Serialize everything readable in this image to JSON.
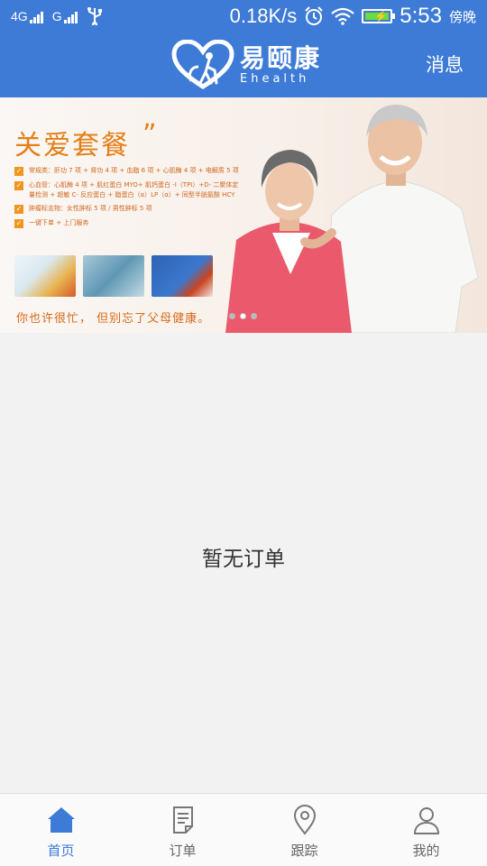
{
  "status_bar": {
    "signal_1": "4G",
    "signal_2": "G",
    "speed": "0.18K/s",
    "time": "5:53",
    "period": "傍晚"
  },
  "app_bar": {
    "logo_cn": "易颐康",
    "logo_en": "Ehealth",
    "messages_label": "消息"
  },
  "banner": {
    "title": "关爱套餐",
    "items": [
      "常规类：肝功 7 项 + 肾功 4 项 + 血脂 6 项 + 心肌酶 4 项 + 电解质 5 项",
      "心血管：心肌酶 4 项 + 肌红蛋白 MYO+ 肌钙蛋白 -I（TPI）+D- 二聚体定量检测 + 超敏 C- 反应蛋白 + 脂蛋白（α）LP（α）+ 同型半胱氨酸 HCY",
      "肿瘤标志物：女性肿标 5 项 / 男性肿标 5 项",
      "一键下单 + 上门服务"
    ],
    "slogan": "你也许很忙，  但别忘了父母健康。",
    "slide_count": 3,
    "active_slide": 2
  },
  "main": {
    "empty_text": "暂无订单"
  },
  "tabs": [
    {
      "label": "首页",
      "icon": "home-icon",
      "active": true
    },
    {
      "label": "订单",
      "icon": "order-icon",
      "active": false
    },
    {
      "label": "跟踪",
      "icon": "location-icon",
      "active": false
    },
    {
      "label": "我的",
      "icon": "user-icon",
      "active": false
    }
  ],
  "colors": {
    "primary": "#3d7bd6",
    "banner_orange": "#e47f17",
    "tab_inactive": "#666666"
  }
}
